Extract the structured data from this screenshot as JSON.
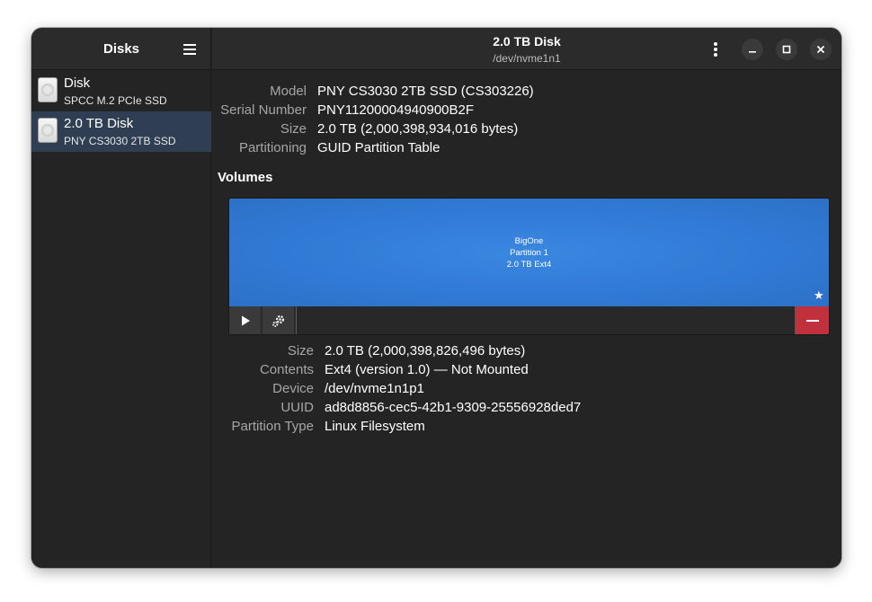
{
  "sidebar": {
    "title": "Disks",
    "items": [
      {
        "name": "Disk",
        "subtitle": "SPCC M.2 PCIe SSD"
      },
      {
        "name": "2.0 TB Disk",
        "subtitle": "PNY CS3030 2TB SSD"
      }
    ]
  },
  "header": {
    "title": "2.0 TB Disk",
    "subtitle": "/dev/nvme1n1"
  },
  "drive": {
    "model_label": "Model",
    "model": "PNY CS3030 2TB SSD (CS303226)",
    "serial_label": "Serial Number",
    "serial": "PNY11200004940900B2F",
    "size_label": "Size",
    "size": "2.0 TB (2,000,398,934,016 bytes)",
    "partitioning_label": "Partitioning",
    "partitioning": "GUID Partition Table"
  },
  "volumes": {
    "title": "Volumes",
    "partition": {
      "name": "BigOne",
      "number": "Partition 1",
      "fs": "2.0 TB Ext4",
      "color": "#3584e4"
    }
  },
  "volume_details": {
    "size_label": "Size",
    "size": "2.0 TB (2,000,398,826,496 bytes)",
    "contents_label": "Contents",
    "contents": "Ext4 (version 1.0) — Not Mounted",
    "device_label": "Device",
    "device": "/dev/nvme1n1p1",
    "uuid_label": "UUID",
    "uuid": "ad8d8856-cec5-42b1-9309-25556928ded7",
    "type_label": "Partition Type",
    "type": "Linux Filesystem"
  },
  "icons": {
    "menu": "hamburger-menu-icon",
    "kebab": "vertical-dots-icon",
    "minimize": "minimize-icon",
    "maximize": "maximize-icon",
    "close": "close-icon",
    "play": "play-icon",
    "settings": "gears-icon",
    "delete": "minus-icon",
    "star": "star-icon"
  },
  "colors": {
    "accent": "#3584e4",
    "destructive": "#c0303d",
    "selected_row": "#2f3e52"
  }
}
